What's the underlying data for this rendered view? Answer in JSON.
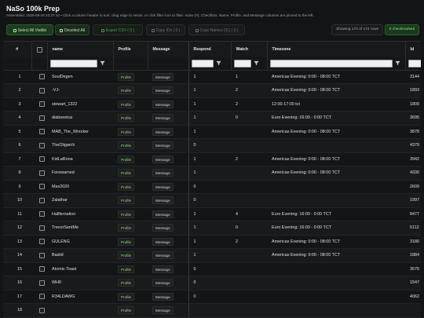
{
  "header": {
    "title": "NaSo 100k Prep",
    "subtitle": "Assembled: 2026-09-28 22:37:44 • Click a column header to sort, drag edge to resize, or click filter icon to filter. Index (#), Checkbox, Name, Profile, and Message columns are pinned to the left."
  },
  "toolbar": {
    "select_all": "Select All Visible",
    "deselect_all": "Deselect All",
    "export_csv": "Export CSV ( 0 )",
    "copy_ids": "Copy IDs ( 0 )",
    "copy_names": "Copy Names (IC) ( 0 )",
    "showing": "Showing 174 of 174 rows",
    "checkmarked": "0 checkmarked"
  },
  "table": {
    "columns": [
      "#",
      "",
      "name",
      "Profile",
      "Message",
      "Respond",
      "Watch",
      "Timezone",
      "Id"
    ],
    "profile_label": "Profile",
    "message_label": "Message",
    "rows": [
      {
        "num": "1",
        "name": "SoulDegen",
        "respond": "1",
        "watch": "1",
        "tz": "Americas Evening: 0:00 - 08:00 TCT",
        "id": "3144"
      },
      {
        "num": "2",
        "name": "-VJ-",
        "respond": "1",
        "watch": "2",
        "tz": "Americas Evening: 0:00 - 08:00 TCT",
        "id": "1893"
      },
      {
        "num": "3",
        "name": "stewart_1322",
        "respond": "1",
        "watch": "2",
        "tz": "12:00-17:00 tct",
        "id": "1809"
      },
      {
        "num": "4",
        "name": "diabeeetus",
        "respond": "1",
        "watch": "0",
        "tz": "Euro Evening: 16:00 - 0:00 TCT",
        "id": "3695"
      },
      {
        "num": "5",
        "name": "MAB_The_Wrecker",
        "respond": "1",
        "watch": "",
        "tz": "Americas Evening: 0:00 - 08:00 TCT",
        "id": "3878"
      },
      {
        "num": "6",
        "name": "TheOligarch",
        "respond": "0",
        "watch": "",
        "tz": "",
        "id": "4379"
      },
      {
        "num": "7",
        "name": "KidLaRona",
        "respond": "1",
        "watch": "2",
        "tz": "Americas Evening: 0:00 - 08:00 TCT",
        "id": "3942"
      },
      {
        "num": "8",
        "name": "Forewarned",
        "respond": "1",
        "watch": "",
        "tz": "Americas Evening: 0:00 - 08:00 TCT",
        "id": "4330"
      },
      {
        "num": "9",
        "name": "Max2020",
        "respond": "0",
        "watch": "",
        "tz": "",
        "id": "2609"
      },
      {
        "num": "10",
        "name": "Zalathar",
        "respond": "0",
        "watch": "",
        "tz": "",
        "id": "1997"
      },
      {
        "num": "11",
        "name": "Halflernation",
        "respond": "1",
        "watch": "4",
        "tz": "Euro Evening: 16:00 - 0:00 TCT",
        "id": "8477"
      },
      {
        "num": "12",
        "name": "TrevorSentMe",
        "respond": "1",
        "watch": "0",
        "tz": "Euro Evening: 16:00 - 0:00 TCT",
        "id": "5112"
      },
      {
        "num": "13",
        "name": "GULENG",
        "respond": "1",
        "watch": "2",
        "tz": "Americas Evening: 0:00 - 08:00 TCT",
        "id": "3180"
      },
      {
        "num": "14",
        "name": "Baslid",
        "respond": "1",
        "watch": "",
        "tz": "Americas Evening: 0:00 - 08:00 TCT",
        "id": "1884"
      },
      {
        "num": "15",
        "name": "Atomic-Toast",
        "respond": "0",
        "watch": "",
        "tz": "",
        "id": "3676"
      },
      {
        "num": "16",
        "name": "WH0",
        "respond": "0",
        "watch": "",
        "tz": "",
        "id": "1547"
      },
      {
        "num": "17",
        "name": "R34LDAWG",
        "respond": "0",
        "watch": "",
        "tz": "",
        "id": "4062"
      },
      {
        "num": "18",
        "name": "",
        "respond": "",
        "watch": "",
        "tz": "",
        "id": ""
      }
    ]
  }
}
